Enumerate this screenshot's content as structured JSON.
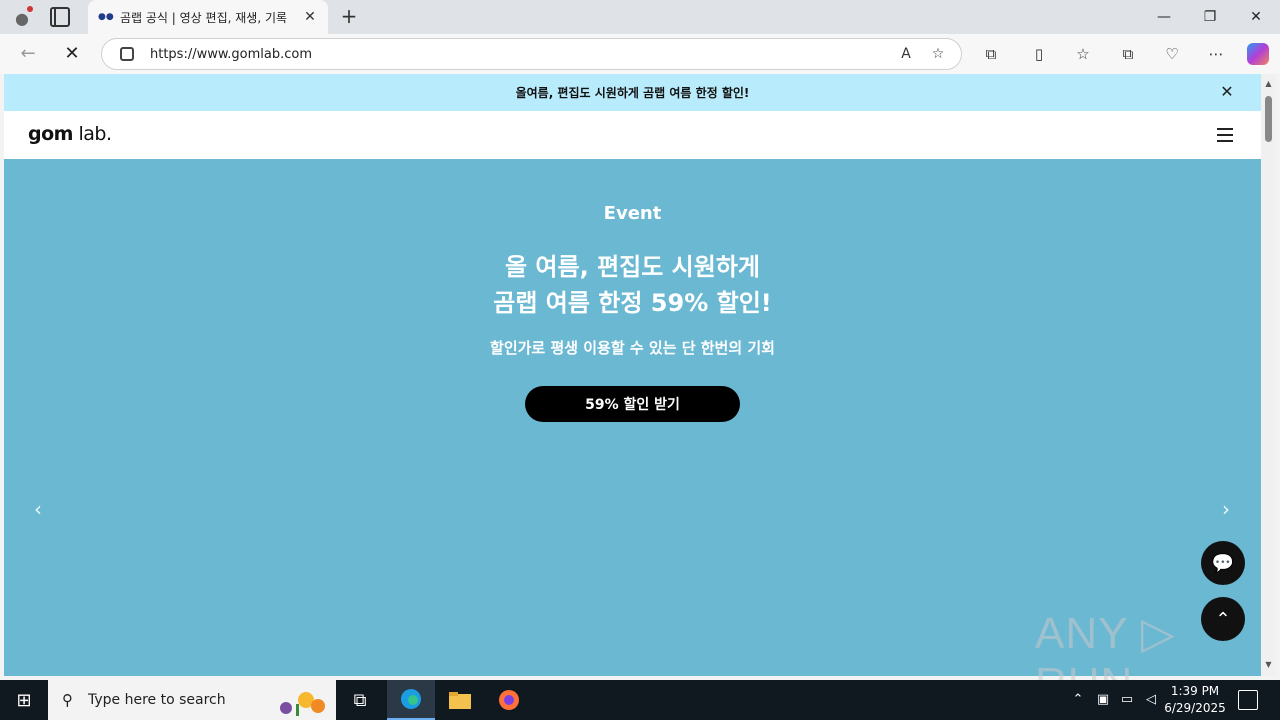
{
  "browser": {
    "tab_title": "곰랩 공식 | 영상 편집, 재생, 기록",
    "tab_favicon": "gomlab-favicon",
    "new_tab_glyph": "+",
    "url": "https://www.gomlab.com",
    "window_controls": {
      "minimize": "—",
      "restore": "❐",
      "close": "✕"
    },
    "nav": {
      "back": "←",
      "stop": "✕"
    }
  },
  "page": {
    "promo_text": "올여름, 편집도 시원하게 곰랩 여름 한정 할인!",
    "logo_text_bold": "gom",
    "logo_text_regular": " lab.",
    "hero": {
      "eyebrow": "Event",
      "headline_line1": "올 여름, 편집도 시원하게",
      "headline_line2": "곰랩 여름 한정 59% 할인!",
      "subtitle": "할인가로 평생 이용할 수 있는 단 한번의 기회",
      "cta_label": "59% 할인 받기",
      "prev_glyph": "‹",
      "next_glyph": "›"
    },
    "colors": {
      "hero_bg": "#6bb8d2",
      "promo_bg": "#b8ebfb",
      "cta_bg": "#000000"
    }
  },
  "watermark": "ANY ▷ RUN",
  "taskbar": {
    "search_placeholder": "Type here to search",
    "time": "1:39 PM",
    "date": "6/29/2025"
  }
}
